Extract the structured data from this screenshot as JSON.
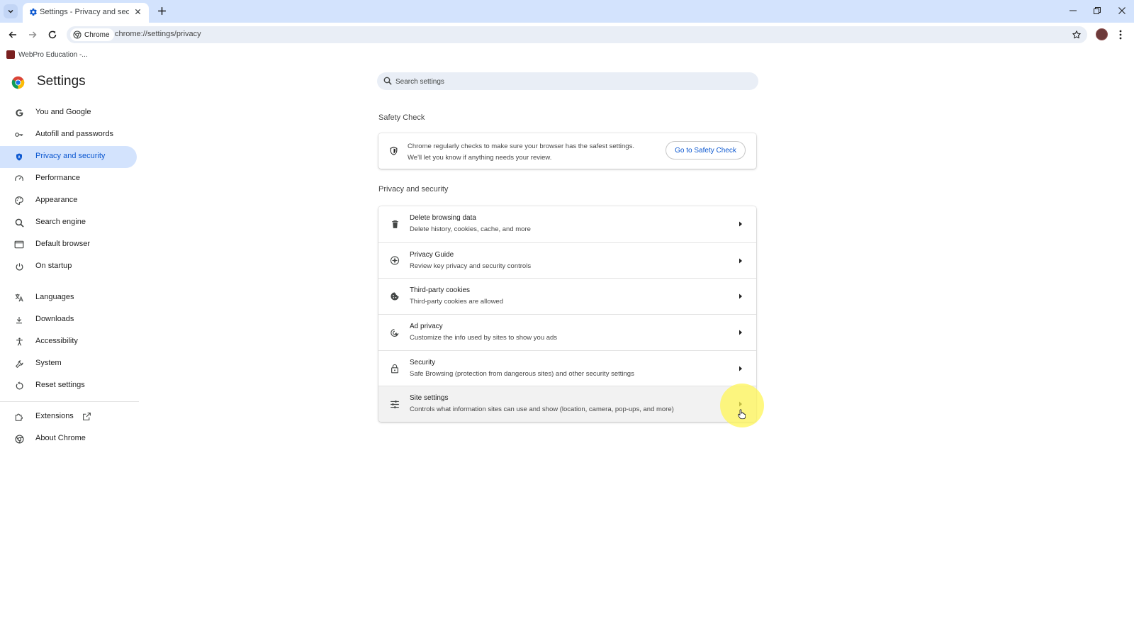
{
  "browser": {
    "tab": {
      "title": "Settings - Privacy and security",
      "favicon": "gear-icon"
    },
    "omnibox": {
      "chip_label": "Chrome",
      "url": "chrome://settings/privacy"
    },
    "bookmarks": [
      {
        "label": "WebPro Education -..."
      }
    ]
  },
  "settings": {
    "title": "Settings",
    "search": {
      "placeholder": "Search settings"
    },
    "sidebar": {
      "items": [
        {
          "label": "You and Google",
          "icon": "google-g-icon"
        },
        {
          "label": "Autofill and passwords",
          "icon": "key-icon"
        },
        {
          "label": "Privacy and security",
          "icon": "shield-icon",
          "active": true
        },
        {
          "label": "Performance",
          "icon": "speedometer-icon"
        },
        {
          "label": "Appearance",
          "icon": "palette-icon"
        },
        {
          "label": "Search engine",
          "icon": "search-icon"
        },
        {
          "label": "Default browser",
          "icon": "browser-window-icon"
        },
        {
          "label": "On startup",
          "icon": "power-icon"
        }
      ],
      "advanced_items": [
        {
          "label": "Languages",
          "icon": "translate-icon"
        },
        {
          "label": "Downloads",
          "icon": "download-icon"
        },
        {
          "label": "Accessibility",
          "icon": "accessibility-icon"
        },
        {
          "label": "System",
          "icon": "wrench-icon"
        },
        {
          "label": "Reset settings",
          "icon": "reset-icon"
        }
      ],
      "footer_items": [
        {
          "label": "Extensions",
          "icon": "puzzle-icon"
        },
        {
          "label": "About Chrome",
          "icon": "chrome-icon"
        }
      ]
    },
    "safety_check": {
      "heading": "Safety Check",
      "line1": "Chrome regularly checks to make sure your browser has the safest settings.",
      "line2": "We'll let you know if anything needs your review.",
      "button": "Go to Safety Check"
    },
    "privacy_section": {
      "heading": "Privacy and security",
      "rows": [
        {
          "title": "Delete browsing data",
          "subtitle": "Delete history, cookies, cache, and more",
          "icon": "trash-icon"
        },
        {
          "title": "Privacy Guide",
          "subtitle": "Review key privacy and security controls",
          "icon": "compass-icon"
        },
        {
          "title": "Third-party cookies",
          "subtitle": "Third-party cookies are allowed",
          "icon": "cookie-icon"
        },
        {
          "title": "Ad privacy",
          "subtitle": "Customize the info used by sites to show you ads",
          "icon": "ad-privacy-icon"
        },
        {
          "title": "Security",
          "subtitle": "Safe Browsing (protection from dangerous sites) and other security settings",
          "icon": "lock-icon"
        },
        {
          "title": "Site settings",
          "subtitle": "Controls what information sites can use and show (location, camera, pop-ups, and more)",
          "icon": "sliders-icon",
          "hovered": true
        }
      ]
    }
  },
  "colors": {
    "accent": "#0b57d0",
    "active_nav_bg": "#d3e3fd",
    "tabstrip_bg": "#d3e3fd",
    "omnibox_bg": "#e9eef6",
    "cursor_highlight": "#fff550"
  }
}
